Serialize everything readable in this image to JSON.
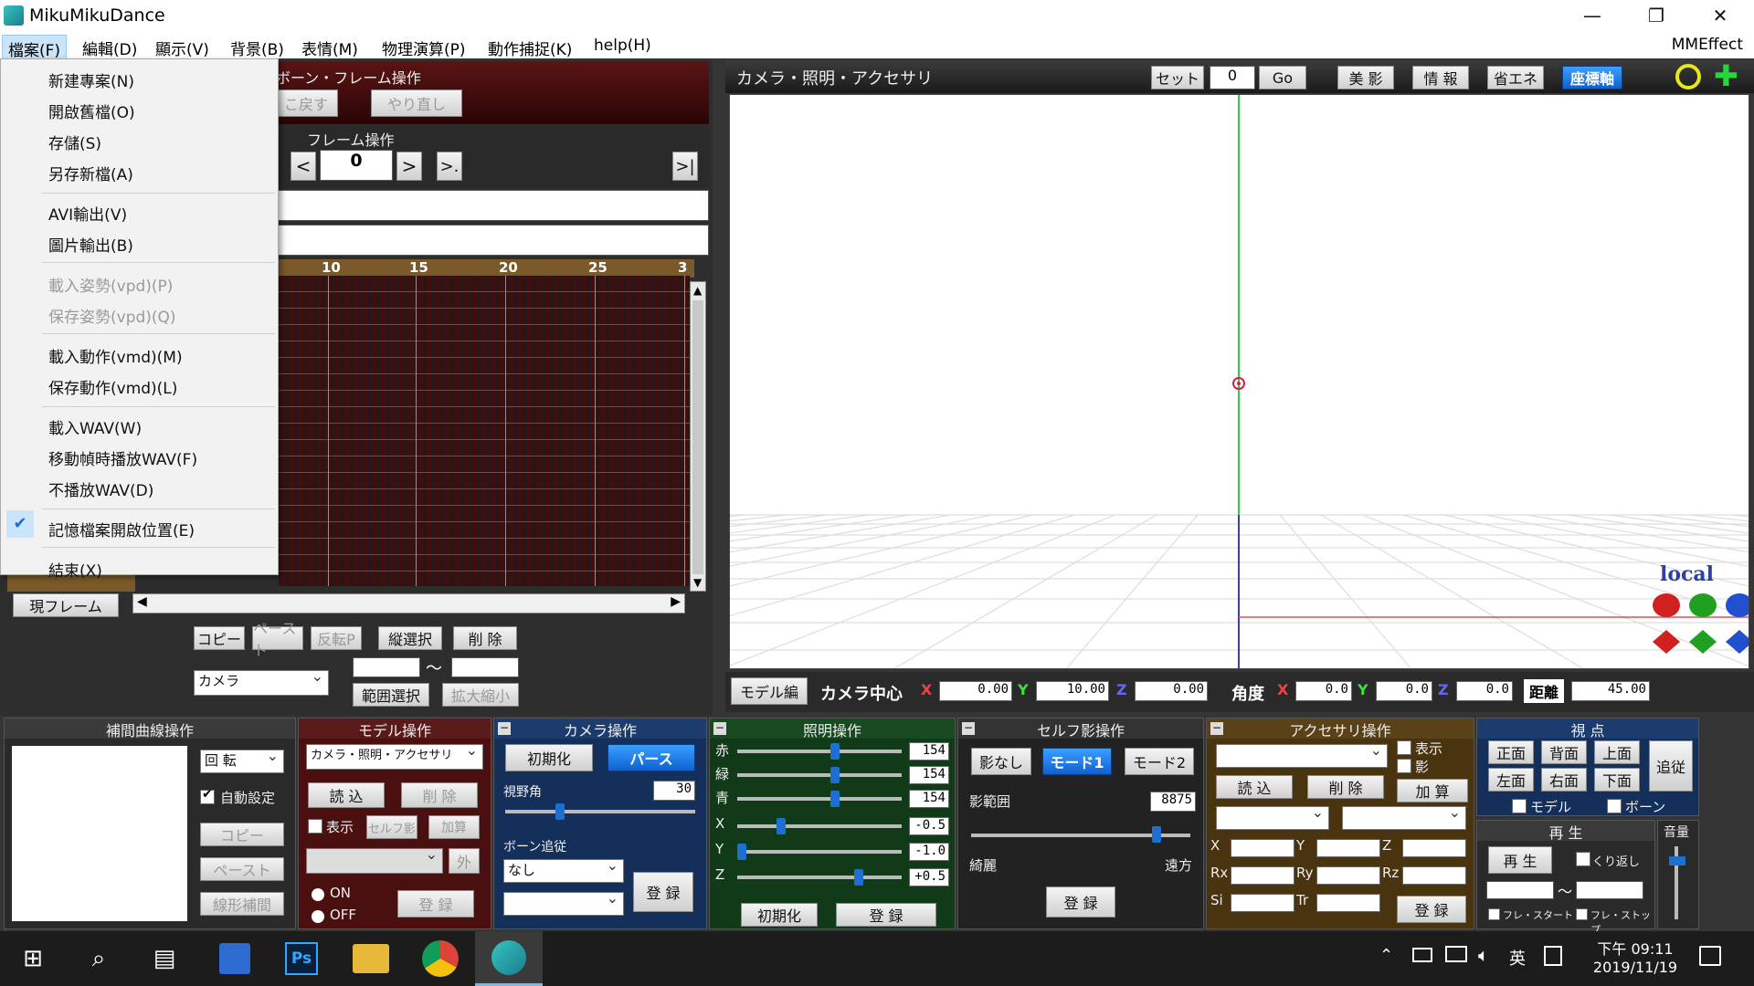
{
  "window": {
    "title": "MikuMikuDance",
    "minimize": "—",
    "restore": "❐",
    "close": "✕"
  },
  "menubar": {
    "items": [
      "檔案(F)",
      "編輯(D)",
      "顯示(V)",
      "背景(B)",
      "表情(M)",
      "物理演算(P)",
      "動作捕捉(K)",
      "help(H)"
    ],
    "right": "MMEffect"
  },
  "file_menu": {
    "items": [
      "新建專案(N)",
      "開啟舊檔(O)",
      "存儲(S)",
      "另存新檔(A)",
      "AVI輸出(V)",
      "圖片輸出(B)",
      "載入姿勢(vpd)(P)",
      "保存姿勢(vpd)(Q)",
      "載入動作(vmd)(M)",
      "保存動作(vmd)(L)",
      "載入WAV(W)",
      "移動幀時播放WAV(F)",
      "不播放WAV(D)",
      "記憶檔案開啟位置(E)",
      "結束(X)"
    ],
    "check_icon": "check-icon"
  },
  "bone_frame": {
    "title": "ボーン・フレーム操作",
    "undo": "こ戻す",
    "redo": "やり直し",
    "frame_ops": "フレーム操作",
    "prev": "<",
    "frame_value": "0",
    "next": ">",
    "next_key": ">.",
    "last": ">|"
  },
  "timeline": {
    "ticks": [
      "10",
      "15",
      "20",
      "25",
      "3"
    ],
    "current_frame_label": "現フレーム",
    "copy": "コピー",
    "paste": "ペースト",
    "invert_paste": "反転P",
    "vertical_select": "縦選択",
    "delete": "削 除",
    "target_select": "カメラ",
    "tilde": "～",
    "range_select": "範囲選択",
    "scale": "拡大縮小"
  },
  "camera_header": {
    "title": "カメラ・照明・アクセサリ",
    "set": "セット",
    "set_value": "0",
    "go": "Go",
    "beauty": "美 影",
    "info": "情 報",
    "eco": "省エネ",
    "axis": "座標軸"
  },
  "viewport": {
    "local_label": "local"
  },
  "camera_bar": {
    "model_edit": "モデル編",
    "camera_center": "カメラ中心",
    "x_label": "X",
    "x_val": "0.00",
    "y_label": "Y",
    "y_val": "10.00",
    "z_label": "Z",
    "z_val": "0.00",
    "angle": "角度",
    "ax_label": "X",
    "ax_val": "0.0",
    "ay_label": "Y",
    "ay_val": "0.0",
    "az_label": "Z",
    "az_val": "0.0",
    "distance": "距離",
    "dist_val": "45.00"
  },
  "interp": {
    "title": "補間曲線操作",
    "rotation": "回 転",
    "auto_setting": "自動設定",
    "copy": "コピー",
    "paste": "ペースト",
    "linear": "線形補間"
  },
  "model_op": {
    "title": "モデル操作",
    "select": "カメラ・照明・アクセサリ",
    "load": "読 込",
    "delete": "削 除",
    "show": "表示",
    "self_shadow": "セルフ影",
    "add": "加算",
    "outer": "外",
    "on": "ON",
    "off": "OFF",
    "register": "登 録"
  },
  "camera_op": {
    "title": "カメラ操作",
    "init": "初期化",
    "perspective": "パース",
    "fov_label": "視野角",
    "fov_value": "30",
    "fov_level": 0.28,
    "bone_follow": "ボーン追従",
    "follow_select": "なし",
    "register": "登 録"
  },
  "light_op": {
    "title": "照明操作",
    "r_label": "赤",
    "r_val": "154",
    "r_level": 0.6,
    "g_label": "緑",
    "g_val": "154",
    "g_level": 0.6,
    "b_label": "青",
    "b_val": "154",
    "b_level": 0.6,
    "x_label": "X",
    "x_val": "-0.5",
    "x_level": 0.25,
    "y_label": "Y",
    "y_val": "-1.0",
    "y_level": 0.0,
    "z_label": "Z",
    "z_val": "+0.5",
    "z_level": 0.75,
    "init": "初期化",
    "register": "登 録"
  },
  "shadow_op": {
    "title": "セルフ影操作",
    "none": "影なし",
    "mode1": "モード1",
    "mode2": "モード2",
    "range_label": "影範囲",
    "range_val": "8875",
    "range_level": 0.86,
    "near": "綺麗",
    "far": "遠方",
    "register": "登 録"
  },
  "accessory_op": {
    "title": "アクセサリ操作",
    "show": "表示",
    "shadow": "影",
    "load": "読 込",
    "delete": "削 除",
    "add": "加 算",
    "x": "X",
    "y": "Y",
    "z": "Z",
    "rx": "Rx",
    "ry": "Ry",
    "rz": "Rz",
    "si": "Si",
    "tr": "Tr",
    "register": "登 録"
  },
  "view_op": {
    "title": "視 点",
    "front": "正面",
    "back": "背面",
    "top": "上面",
    "left": "左面",
    "right": "右面",
    "bottom": "下面",
    "follow": "追従",
    "model": "モデル",
    "bone": "ボーン"
  },
  "play_op": {
    "title": "再 生",
    "play": "再 生",
    "repeat": "くり返し",
    "tilde": "～",
    "frame_start": "フレ・スタート",
    "frame_stop": "フレ・ストップ",
    "volume": "音量",
    "volume_level": 0.85
  },
  "taskbar": {
    "time": "下午 09:11",
    "date": "2019/11/19",
    "ime": "英"
  },
  "colors": {
    "accent_blue": "#1d6fd0",
    "menu_highlight": "#cce4f7",
    "panel_red": "#4a1010",
    "panel_blue": "#14305a",
    "panel_green": "#103a18",
    "panel_brown": "#4a3410"
  }
}
